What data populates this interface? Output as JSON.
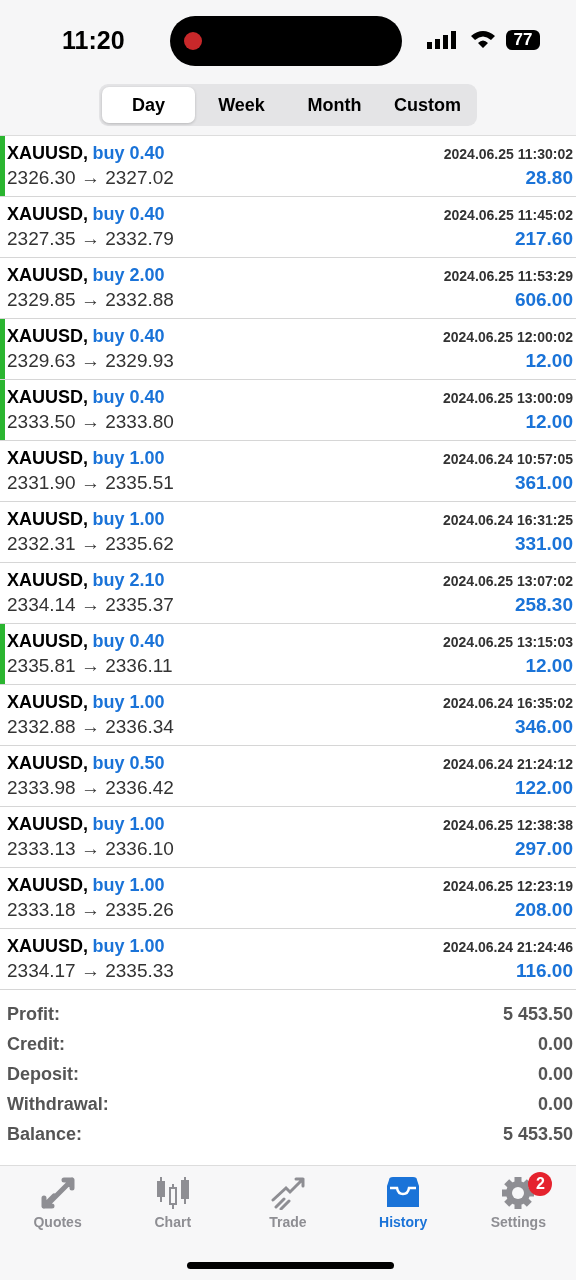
{
  "status_bar": {
    "time": "11:20",
    "battery": "77"
  },
  "tabs": [
    {
      "label": "Day",
      "selected": true
    },
    {
      "label": "Week",
      "selected": false
    },
    {
      "label": "Month",
      "selected": false
    },
    {
      "label": "Custom",
      "selected": false
    }
  ],
  "deals": [
    {
      "symbol": "XAUUSD,",
      "side": "buy 0.40",
      "time": "2024.06.25 11:30:02",
      "prices": "2326.30 → 2327.02",
      "profit": "28.80",
      "highlighted": true
    },
    {
      "symbol": "XAUUSD,",
      "side": "buy 0.40",
      "time": "2024.06.25 11:45:02",
      "prices": "2327.35 → 2332.79",
      "profit": "217.60",
      "highlighted": false
    },
    {
      "symbol": "XAUUSD,",
      "side": "buy 2.00",
      "time": "2024.06.25 11:53:29",
      "prices": "2329.85 → 2332.88",
      "profit": "606.00",
      "highlighted": false
    },
    {
      "symbol": "XAUUSD,",
      "side": "buy 0.40",
      "time": "2024.06.25 12:00:02",
      "prices": "2329.63 → 2329.93",
      "profit": "12.00",
      "highlighted": true
    },
    {
      "symbol": "XAUUSD,",
      "side": "buy 0.40",
      "time": "2024.06.25 13:00:09",
      "prices": "2333.50 → 2333.80",
      "profit": "12.00",
      "highlighted": true
    },
    {
      "symbol": "XAUUSD,",
      "side": "buy 1.00",
      "time": "2024.06.24 10:57:05",
      "prices": "2331.90 → 2335.51",
      "profit": "361.00",
      "highlighted": false
    },
    {
      "symbol": "XAUUSD,",
      "side": "buy 1.00",
      "time": "2024.06.24 16:31:25",
      "prices": "2332.31 → 2335.62",
      "profit": "331.00",
      "highlighted": false
    },
    {
      "symbol": "XAUUSD,",
      "side": "buy 2.10",
      "time": "2024.06.25 13:07:02",
      "prices": "2334.14 → 2335.37",
      "profit": "258.30",
      "highlighted": false
    },
    {
      "symbol": "XAUUSD,",
      "side": "buy 0.40",
      "time": "2024.06.25 13:15:03",
      "prices": "2335.81 → 2336.11",
      "profit": "12.00",
      "highlighted": true
    },
    {
      "symbol": "XAUUSD,",
      "side": "buy 1.00",
      "time": "2024.06.24 16:35:02",
      "prices": "2332.88 → 2336.34",
      "profit": "346.00",
      "highlighted": false
    },
    {
      "symbol": "XAUUSD,",
      "side": "buy 0.50",
      "time": "2024.06.24 21:24:12",
      "prices": "2333.98 → 2336.42",
      "profit": "122.00",
      "highlighted": false
    },
    {
      "symbol": "XAUUSD,",
      "side": "buy 1.00",
      "time": "2024.06.25 12:38:38",
      "prices": "2333.13 → 2336.10",
      "profit": "297.00",
      "highlighted": false
    },
    {
      "symbol": "XAUUSD,",
      "side": "buy 1.00",
      "time": "2024.06.25 12:23:19",
      "prices": "2333.18 → 2335.26",
      "profit": "208.00",
      "highlighted": false
    },
    {
      "symbol": "XAUUSD,",
      "side": "buy 1.00",
      "time": "2024.06.24 21:24:46",
      "prices": "2334.17 → 2335.33",
      "profit": "116.00",
      "highlighted": false
    }
  ],
  "summary": [
    {
      "label": "Profit:",
      "value": "5 453.50"
    },
    {
      "label": "Credit:",
      "value": "0.00"
    },
    {
      "label": "Deposit:",
      "value": "0.00"
    },
    {
      "label": "Withdrawal:",
      "value": "0.00"
    },
    {
      "label": "Balance:",
      "value": "5 453.50"
    }
  ],
  "tab_bar": [
    {
      "kind": "quotes",
      "label": "Quotes",
      "selected": false
    },
    {
      "kind": "chart",
      "label": "Chart",
      "selected": false
    },
    {
      "kind": "trade",
      "label": "Trade",
      "selected": false
    },
    {
      "kind": "history",
      "label": "History",
      "selected": true
    },
    {
      "kind": "settings",
      "label": "Settings",
      "selected": false,
      "badge": "2"
    }
  ]
}
